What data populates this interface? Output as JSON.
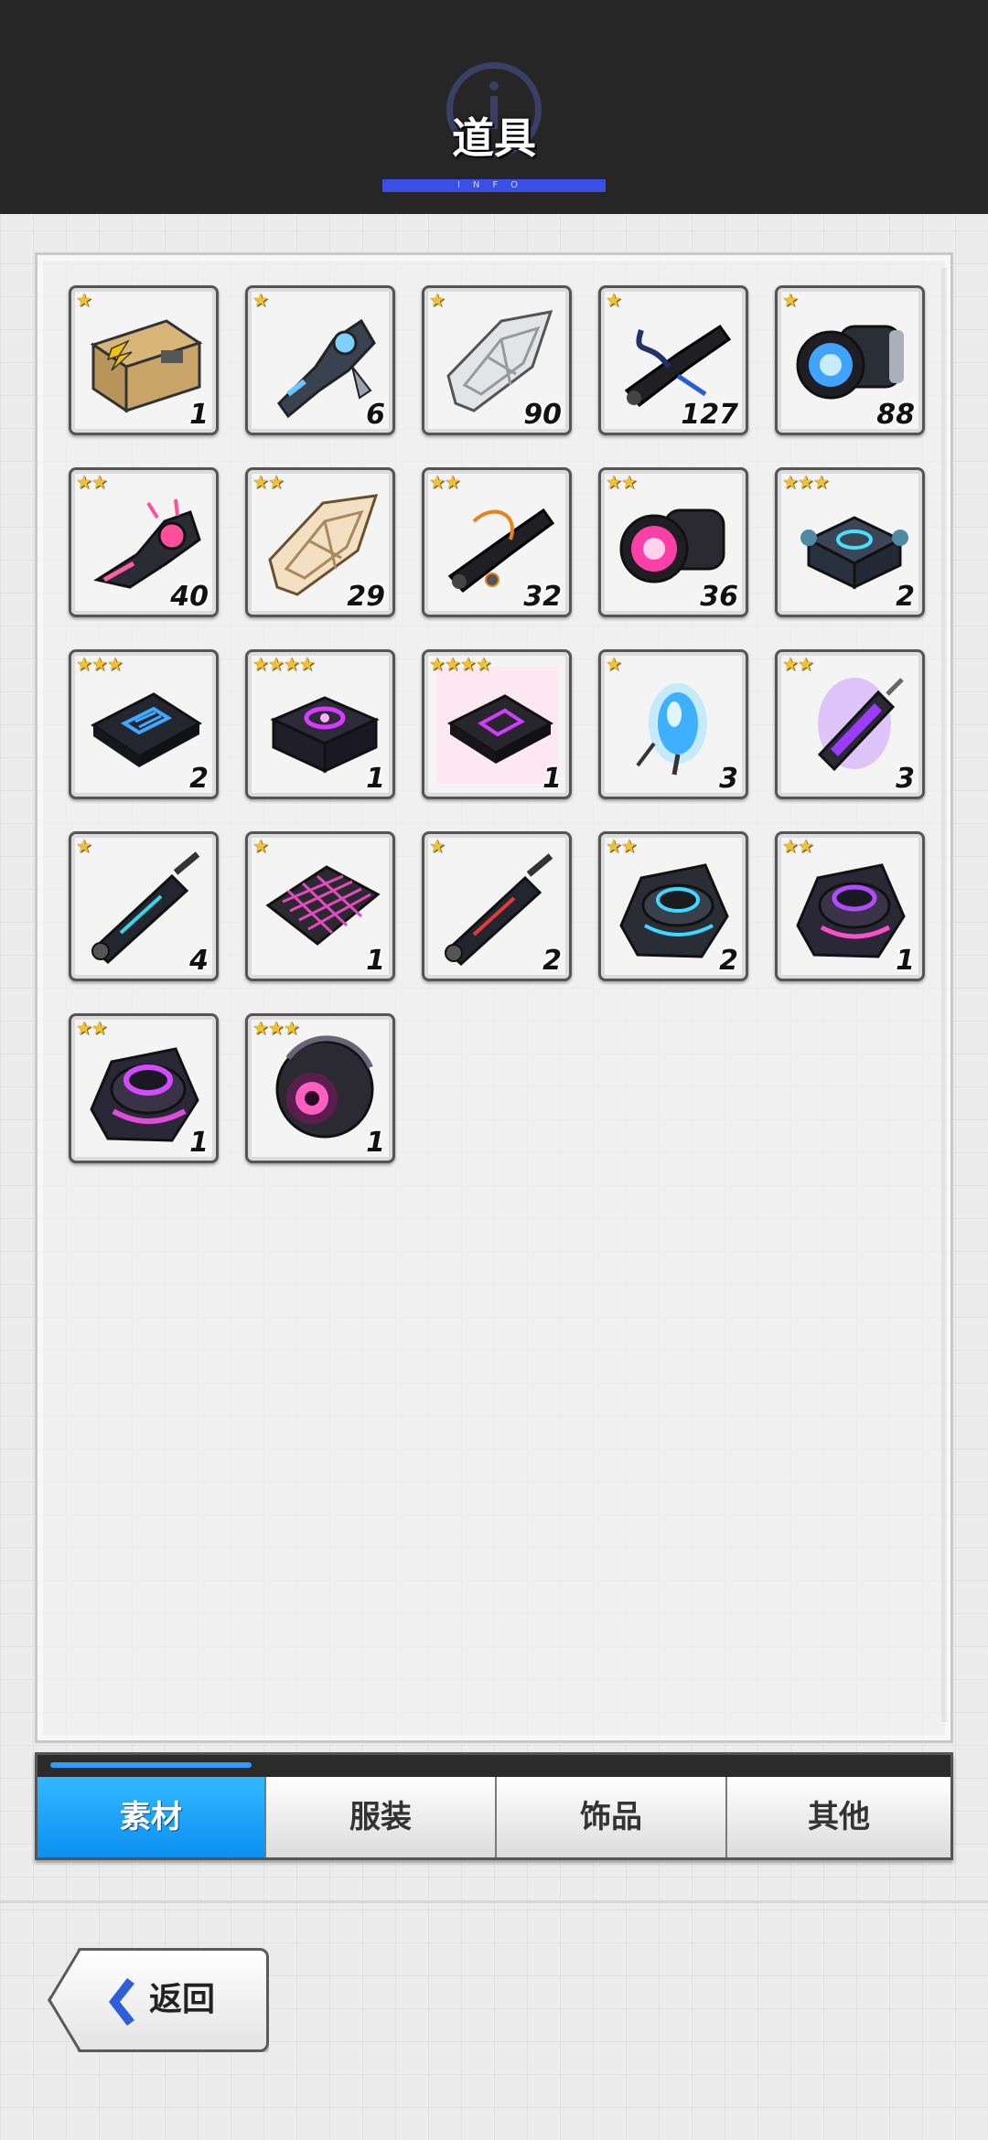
{
  "header": {
    "title": "道具",
    "subtitle": "INFO"
  },
  "items": [
    {
      "stars": "★",
      "count": "1",
      "icon": "lightning-box-icon"
    },
    {
      "stars": "★",
      "count": "6",
      "icon": "mech-arm-blue-icon"
    },
    {
      "stars": "★",
      "count": "90",
      "icon": "silver-frame-icon"
    },
    {
      "stars": "★",
      "count": "127",
      "icon": "black-cable-icon"
    },
    {
      "stars": "★",
      "count": "88",
      "icon": "blue-lens-icon"
    },
    {
      "stars": "★★",
      "count": "40",
      "icon": "mech-arm-pink-icon"
    },
    {
      "stars": "★★",
      "count": "29",
      "icon": "gold-frame-icon"
    },
    {
      "stars": "★★",
      "count": "32",
      "icon": "orange-cable-icon"
    },
    {
      "stars": "★★",
      "count": "36",
      "icon": "pink-lens-icon"
    },
    {
      "stars": "★★★",
      "count": "2",
      "icon": "cyan-core-module-icon"
    },
    {
      "stars": "★★★",
      "count": "2",
      "icon": "blue-chip-icon"
    },
    {
      "stars": "★★★★",
      "count": "1",
      "icon": "purple-core-module-icon"
    },
    {
      "stars": "★★★★",
      "count": "1",
      "icon": "pink-chip-icon"
    },
    {
      "stars": "★",
      "count": "3",
      "icon": "blue-crystal-icon"
    },
    {
      "stars": "★★",
      "count": "3",
      "icon": "purple-crystal-icon"
    },
    {
      "stars": "★",
      "count": "4",
      "icon": "cyan-cylinder-icon"
    },
    {
      "stars": "★",
      "count": "1",
      "icon": "pink-mesh-icon"
    },
    {
      "stars": "★",
      "count": "2",
      "icon": "red-cylinder-icon"
    },
    {
      "stars": "★★",
      "count": "2",
      "icon": "cyan-turbine-icon"
    },
    {
      "stars": "★★",
      "count": "1",
      "icon": "purple-turbine-icon"
    },
    {
      "stars": "★★",
      "count": "1",
      "icon": "magenta-turbine-icon"
    },
    {
      "stars": "★★★",
      "count": "1",
      "icon": "eye-sphere-icon"
    }
  ],
  "tabs": [
    {
      "label": "素材",
      "active": true
    },
    {
      "label": "服装",
      "active": false
    },
    {
      "label": "饰品",
      "active": false
    },
    {
      "label": "其他",
      "active": false
    }
  ],
  "back_button": {
    "label": "返回"
  },
  "colors": {
    "accent": "#1aa3ff",
    "header_bg": "#262626",
    "star": "#f2c12e",
    "header_bar": "#3b4ee6"
  }
}
